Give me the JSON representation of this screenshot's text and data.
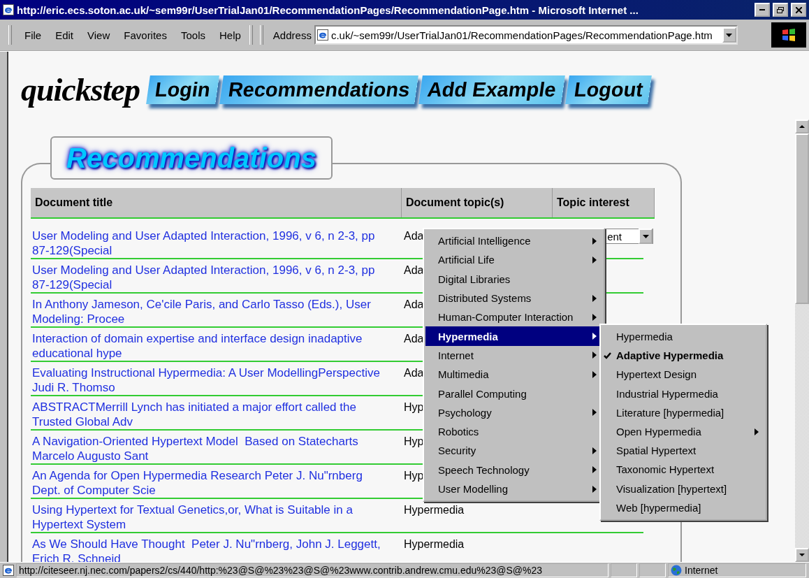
{
  "window": {
    "title": "http://eric.ecs.soton.ac.uk/~sem99r/UserTrialJan01/RecommendationPages/RecommendationPage.htm - Microsoft Internet ..."
  },
  "menu_bar": [
    "File",
    "Edit",
    "View",
    "Favorites",
    "Tools",
    "Help"
  ],
  "address_bar": {
    "label": "Address",
    "value": "c.uk/~sem99r/UserTrialJan01/RecommendationPages/RecommendationPage.htm"
  },
  "site": {
    "logo": "quickstep",
    "nav": [
      "Login",
      "Recommendations",
      "Add Example",
      "Logout"
    ]
  },
  "section_title": "Recommendations",
  "table": {
    "columns": [
      "Document title",
      "Document topic(s)",
      "Topic interest"
    ],
    "rows": [
      {
        "title": "User Modeling and User Adapted Interaction, 1996, v 6, n 2-3, pp 87-129(Special",
        "topic": "Ada",
        "interest": "ent"
      },
      {
        "title": "User Modeling and User Adapted Interaction, 1996, v 6, n 2-3, pp 87-129(Special",
        "topic": "Ada"
      },
      {
        "title": "In Anthony Jameson, Ce'cile Paris, and Carlo Tasso (Eds.), User Modeling: Procee",
        "topic": "Ada"
      },
      {
        "title": "Interaction of domain expertise and interface design inadaptive educational hype",
        "topic": "Ada"
      },
      {
        "title": "Evaluating Instructional Hypermedia: A User ModellingPerspective Judi R. Thomso",
        "topic": "Ada"
      },
      {
        "title": "ABSTRACTMerrill Lynch has initiated a major effort called the Trusted Global Adv",
        "topic": "Hyp"
      },
      {
        "title": "A Navigation-Oriented Hypertext Model  Based on Statecharts Marcelo Augusto Sant",
        "topic": "Hyp"
      },
      {
        "title": "An Agenda for Open Hypermedia Research Peter J. Nu\"rnberg Dept. of Computer Scie",
        "topic": "Hyp"
      },
      {
        "title": "Using Hypertext for Textual Genetics,or, What is Suitable in a Hypertext System",
        "topic": "Hypermedia"
      },
      {
        "title": "As We Should Have Thought  Peter J. Nu\"rnberg, John J. Leggett, Erich R. Schneid",
        "topic": "Hypermedia"
      }
    ]
  },
  "context_menu": {
    "items": [
      {
        "label": "Artificial Intelligence",
        "submenu": true,
        "selected": false
      },
      {
        "label": "Artificial Life",
        "submenu": true,
        "selected": false
      },
      {
        "label": "Digital Libraries",
        "submenu": false,
        "selected": false
      },
      {
        "label": "Distributed Systems",
        "submenu": true,
        "selected": false
      },
      {
        "label": "Human-Computer Interaction",
        "submenu": true,
        "selected": false
      },
      {
        "label": "Hypermedia",
        "submenu": true,
        "selected": true
      },
      {
        "label": "Internet",
        "submenu": true,
        "selected": false
      },
      {
        "label": "Multimedia",
        "submenu": true,
        "selected": false
      },
      {
        "label": "Parallel Computing",
        "submenu": false,
        "selected": false
      },
      {
        "label": "Psychology",
        "submenu": true,
        "selected": false
      },
      {
        "label": "Robotics",
        "submenu": false,
        "selected": false
      },
      {
        "label": "Security",
        "submenu": true,
        "selected": false
      },
      {
        "label": "Speech Technology",
        "submenu": true,
        "selected": false
      },
      {
        "label": "User Modelling",
        "submenu": true,
        "selected": false
      }
    ]
  },
  "submenu": {
    "items": [
      {
        "label": "Hypermedia",
        "checked": false,
        "submenu": false
      },
      {
        "label": "Adaptive Hypermedia",
        "checked": true,
        "submenu": false
      },
      {
        "label": "Hypertext Design",
        "checked": false,
        "submenu": false
      },
      {
        "label": "Industrial Hypermedia",
        "checked": false,
        "submenu": false
      },
      {
        "label": "Literature [hypermedia]",
        "checked": false,
        "submenu": false
      },
      {
        "label": "Open Hypermedia",
        "checked": false,
        "submenu": true
      },
      {
        "label": "Spatial Hypertext",
        "checked": false,
        "submenu": false
      },
      {
        "label": "Taxonomic Hypertext",
        "checked": false,
        "submenu": false
      },
      {
        "label": "Visualization [hypertext]",
        "checked": false,
        "submenu": false
      },
      {
        "label": "Web [hypermedia]",
        "checked": false,
        "submenu": false
      }
    ]
  },
  "status_bar": {
    "url": "http://citeseer.nj.nec.com/papers2/cs/440/http:%23@S@%23%23@S@%23www.contrib.andrew.cmu.edu%23@S@%23",
    "zone": "Internet"
  }
}
